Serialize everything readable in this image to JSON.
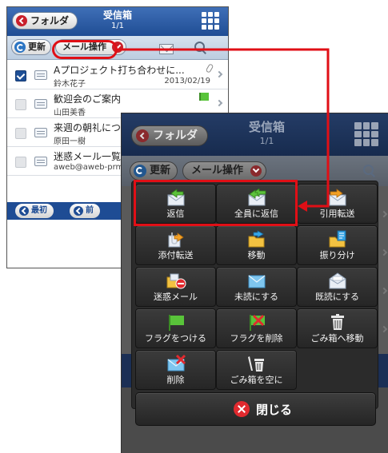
{
  "background_screen": {
    "back_label": "フォルダ",
    "title": "受信箱",
    "page": "1/1",
    "refresh_label": "更新",
    "mail_ops_label": "メール操作",
    "mails": [
      {
        "subject": "Aプロジェクト打ち合わせに...",
        "from": "鈴木花子",
        "date": "2013/02/19",
        "checked": true,
        "marker": "clip"
      },
      {
        "subject": "歓迎会のご案内",
        "from": "山田美香",
        "date": "",
        "checked": false,
        "marker": "flag"
      },
      {
        "subject": "来週の朝礼につ",
        "from": "原田一樹",
        "date": "",
        "checked": false,
        "marker": ""
      },
      {
        "subject": "迷惑メール一覧",
        "from": "aweb@aweb-prm",
        "date": "",
        "checked": false,
        "marker": ""
      }
    ],
    "pager": {
      "first_label": "最初",
      "prev_label": "前"
    }
  },
  "menu_screen": {
    "back_label": "フォルダ",
    "title": "受信箱",
    "page": "1/1",
    "refresh_label": "更新",
    "mail_ops_label": "メール操作",
    "buttons": [
      {
        "label": "返信",
        "icon": "reply-icon"
      },
      {
        "label": "全員に返信",
        "icon": "reply-all-icon"
      },
      {
        "label": "引用転送",
        "icon": "forward-quote-icon"
      },
      {
        "label": "添付転送",
        "icon": "forward-attach-icon"
      },
      {
        "label": "移動",
        "icon": "move-folder-icon"
      },
      {
        "label": "振り分け",
        "icon": "sort-icon"
      },
      {
        "label": "迷惑メール",
        "icon": "spam-icon"
      },
      {
        "label": "未読にする",
        "icon": "mark-unread-icon"
      },
      {
        "label": "既読にする",
        "icon": "mark-read-icon"
      },
      {
        "label": "フラグをつける",
        "icon": "flag-icon"
      },
      {
        "label": "フラグを削除",
        "icon": "flag-remove-icon"
      },
      {
        "label": "ごみ箱へ移動",
        "icon": "trash-icon"
      },
      {
        "label": "削除",
        "icon": "delete-icon"
      },
      {
        "label": "ごみ箱を空に",
        "icon": "empty-trash-icon"
      }
    ],
    "close_label": "閉じる"
  },
  "colors": {
    "highlight": "#e00f16",
    "header_blue": "#1f4d94",
    "menu_dark": "#2b2b2b",
    "flag_green": "#59c43a"
  }
}
